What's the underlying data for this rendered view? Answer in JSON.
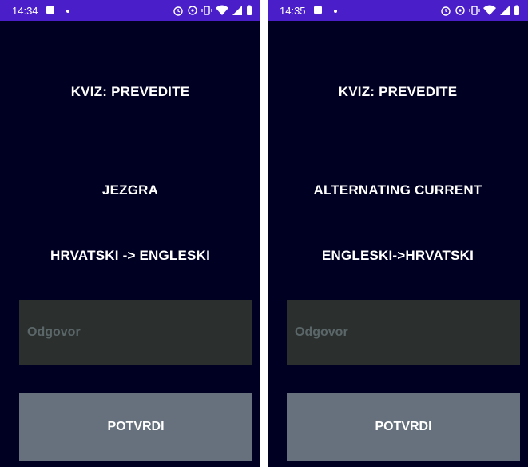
{
  "screens": [
    {
      "status_time": "14:34",
      "title": "KVIZ: PREVEDITE",
      "word": "JEZGRA",
      "direction": "HRVATSKI -> ENGLESKI",
      "answer_placeholder": "Odgovor",
      "confirm_label": "POTVRDI"
    },
    {
      "status_time": "14:35",
      "title": "KVIZ: PREVEDITE",
      "word": "ALTERNATING CURRENT",
      "direction": "ENGLESKI->HRVATSKI",
      "answer_placeholder": "Odgovor",
      "confirm_label": "POTVRDI"
    }
  ],
  "colors": {
    "background": "#000122",
    "status_bar": "#4a1fc9",
    "answer_field": "#2b2f2e",
    "confirm_button": "#66717d",
    "placeholder": "#5a6668"
  },
  "icons": {
    "status_left": [
      "image-notification-icon",
      "dot-icon"
    ],
    "status_right": [
      "alarm-icon",
      "data-saver-icon",
      "vibrate-icon",
      "wifi-icon",
      "signal-icon",
      "battery-icon"
    ]
  }
}
